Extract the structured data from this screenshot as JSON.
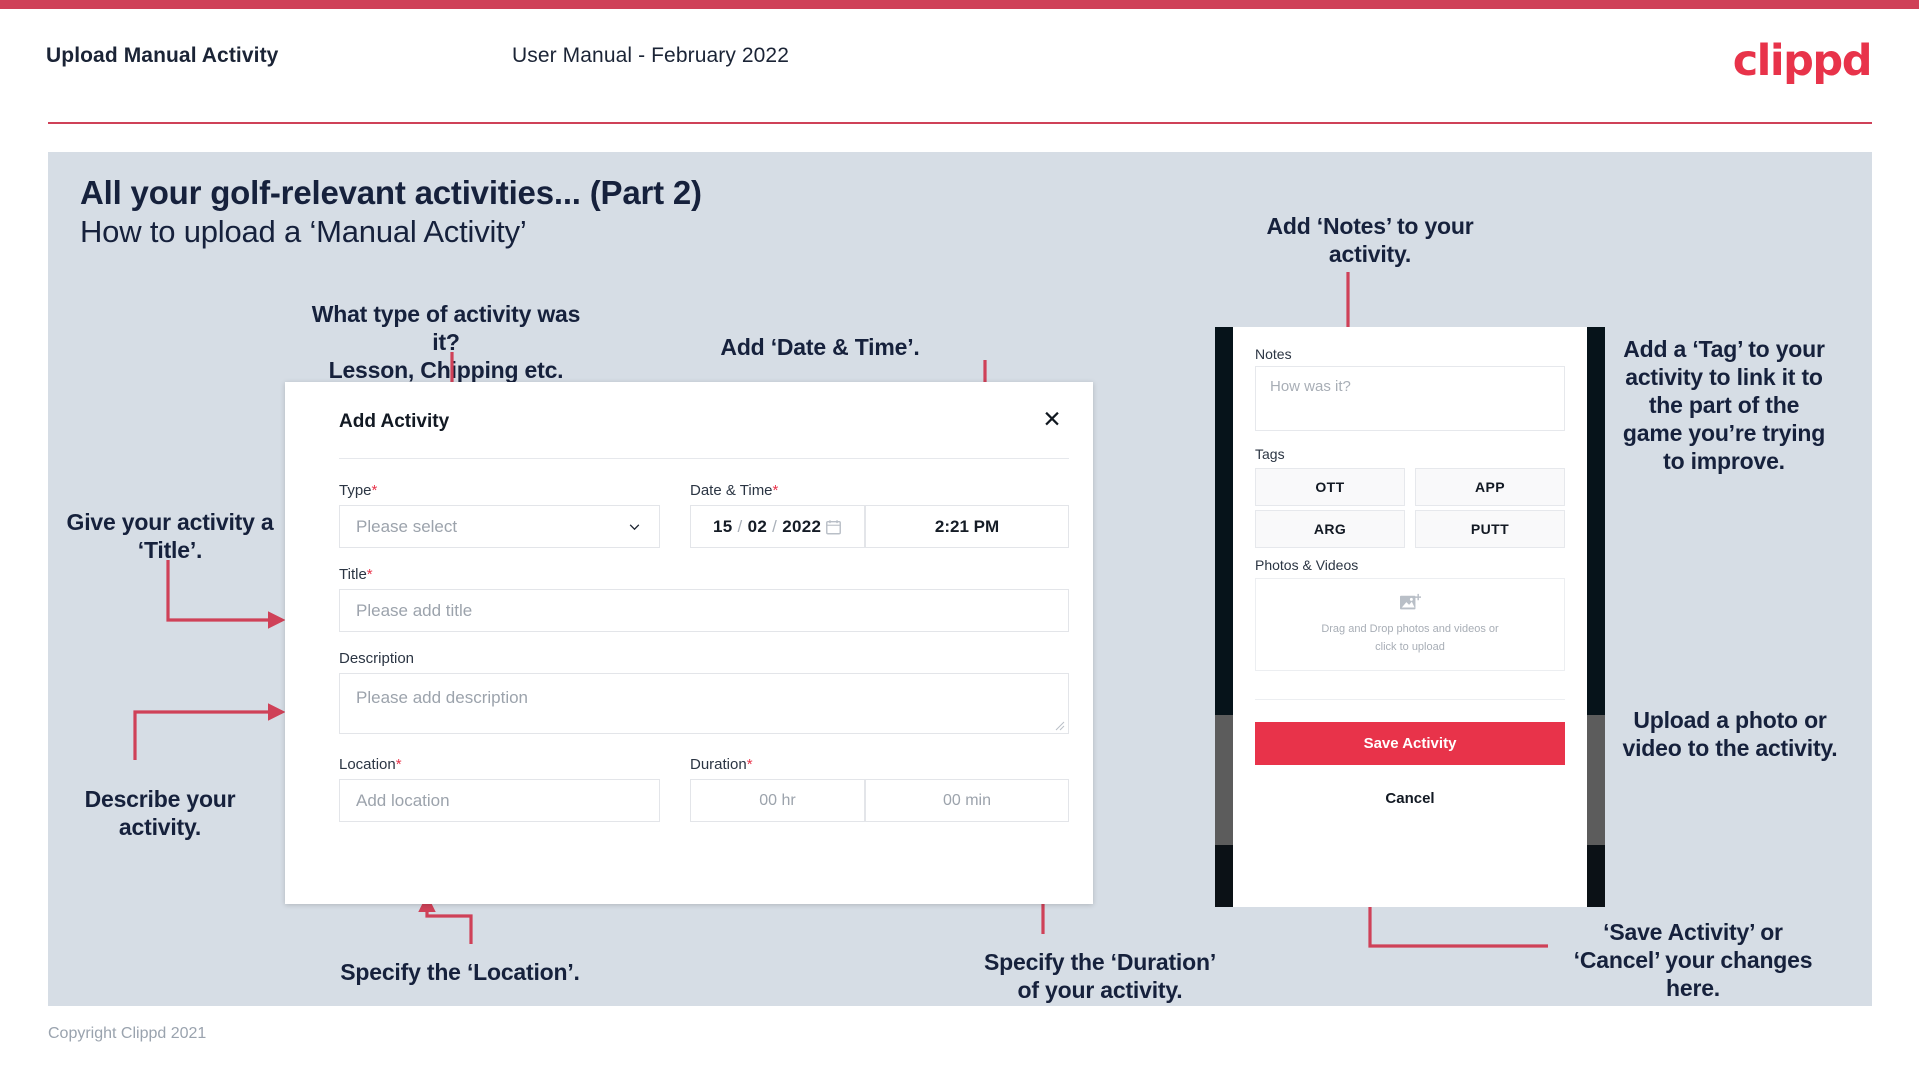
{
  "header": {
    "title": "Upload Manual Activity",
    "subtitle": "User Manual - February 2022",
    "logo": "clippd"
  },
  "slide": {
    "title": "All your golf-relevant activities... (Part 2)",
    "subtitle": "How to upload a ‘Manual Activity’"
  },
  "footer": {
    "copyright": "Copyright Clippd 2021"
  },
  "annotations": {
    "type": "What type of activity was it?\nLesson, Chipping etc.",
    "datetime": "Add ‘Date & Time’.",
    "title": "Give your activity a\n‘Title’.",
    "description": "Describe your\nactivity.",
    "location": "Specify the ‘Location’.",
    "duration": "Specify the ‘Duration’\nof your activity.",
    "notes": "Add ‘Notes’ to your\nactivity.",
    "tags": "Add a ‘Tag’ to your\nactivity to link it to\nthe part of the\ngame you’re trying\nto improve.",
    "upload": "Upload a photo or\nvideo to the activity.",
    "save": "‘Save Activity’ or\n‘Cancel’ your changes\nhere."
  },
  "dialog": {
    "title": "Add Activity",
    "close_icon": "close-icon",
    "fields": {
      "type": {
        "label": "Type",
        "required": "*",
        "placeholder": "Please select"
      },
      "datetime": {
        "label": "Date & Time",
        "required": "*",
        "day": "15",
        "month": "02",
        "year": "2022",
        "time": "2:21 PM"
      },
      "title": {
        "label": "Title",
        "required": "*",
        "placeholder": "Please add title"
      },
      "description": {
        "label": "Description",
        "required": "",
        "placeholder": "Please add description"
      },
      "location": {
        "label": "Location",
        "required": "*",
        "placeholder": "Add location"
      },
      "duration": {
        "label": "Duration",
        "required": "*",
        "hours": "00 hr",
        "minutes": "00 min"
      }
    }
  },
  "mobile": {
    "notes": {
      "label": "Notes",
      "placeholder": "How was it?"
    },
    "tags": {
      "label": "Tags",
      "items": [
        "OTT",
        "APP",
        "ARG",
        "PUTT"
      ]
    },
    "photos": {
      "label": "Photos & Videos",
      "dropzone_line1": "Drag and Drop photos and videos or",
      "dropzone_line2": "click to upload"
    },
    "save_label": "Save Activity",
    "cancel_label": "Cancel"
  },
  "colors": {
    "brand_red": "#e8334a",
    "arrow_red": "#cf4158",
    "slide_bg": "#d6dde5",
    "text_dark": "#16213c"
  }
}
